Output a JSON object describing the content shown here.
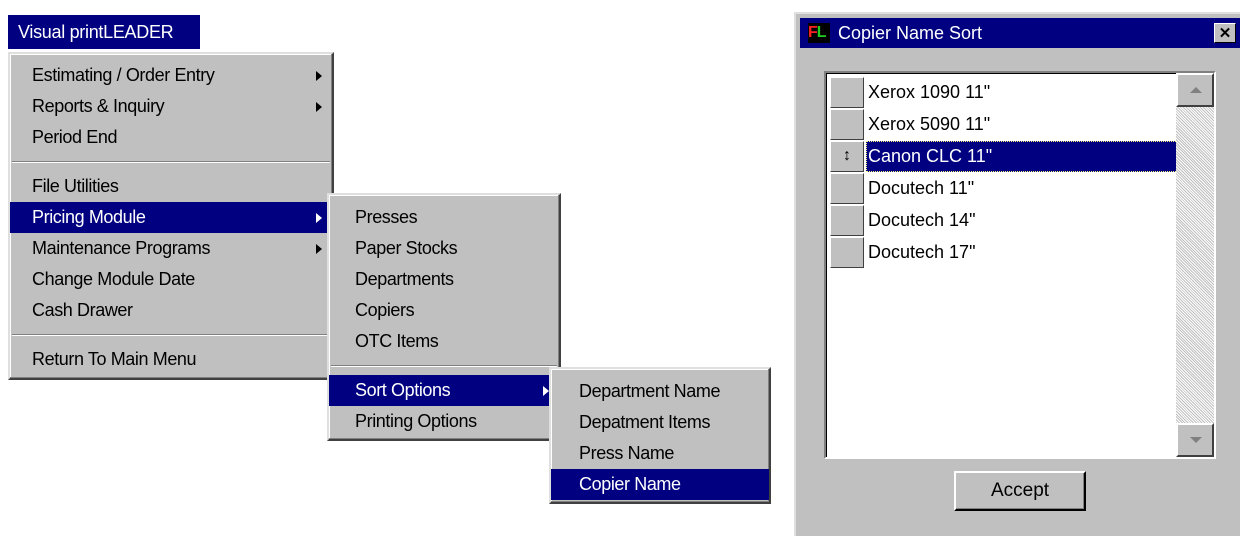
{
  "menubar": {
    "title": "Visual printLEADER"
  },
  "main_menu": {
    "items": [
      {
        "label": "Estimating / Order Entry",
        "submenu": true
      },
      {
        "label": "Reports & Inquiry",
        "submenu": true
      },
      {
        "label": "Period End",
        "submenu": false
      },
      {
        "label": "File Utilities",
        "submenu": false
      },
      {
        "label": "Pricing Module",
        "submenu": true,
        "highlighted": true
      },
      {
        "label": "Maintenance Programs",
        "submenu": true
      },
      {
        "label": "Change Module Date",
        "submenu": false
      },
      {
        "label": "Cash Drawer",
        "submenu": false
      },
      {
        "label": "Return To Main Menu",
        "submenu": false
      }
    ]
  },
  "pricing_menu": {
    "items": [
      {
        "label": "Presses"
      },
      {
        "label": "Paper Stocks"
      },
      {
        "label": "Departments"
      },
      {
        "label": "Copiers"
      },
      {
        "label": "OTC Items"
      },
      {
        "label": "Sort Options",
        "submenu": true,
        "highlighted": true
      },
      {
        "label": "Printing Options"
      }
    ]
  },
  "sort_menu": {
    "items": [
      {
        "label": "Department Name"
      },
      {
        "label": "Depatment Items"
      },
      {
        "label": "Press Name"
      },
      {
        "label": "Copier Name",
        "highlighted": true
      }
    ]
  },
  "dialog": {
    "title": "Copier Name Sort",
    "icon_text": {
      "f": "F",
      "l": "L"
    },
    "close_glyph": "✕",
    "list": [
      {
        "name": "Xerox 1090 11\"",
        "selected": false
      },
      {
        "name": "Xerox 5090 11\"",
        "selected": false
      },
      {
        "name": "Canon CLC 11\"",
        "selected": true,
        "handle_glyph": "↕"
      },
      {
        "name": "Docutech 11\"",
        "selected": false
      },
      {
        "name": "Docutech 14\"",
        "selected": false
      },
      {
        "name": "Docutech 17\"",
        "selected": false
      }
    ],
    "accept_label": "Accept"
  },
  "colors": {
    "highlight": "#000080",
    "face": "#c0c0c0",
    "icon_f": "#ff2020",
    "icon_l": "#20d020"
  }
}
